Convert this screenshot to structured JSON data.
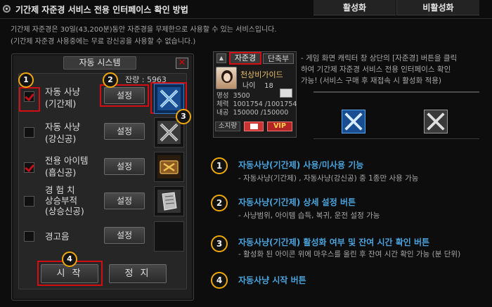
{
  "header": {
    "title": "기간제 자준경 서비스 전용 인터페이스 확인 방법"
  },
  "intro": [
    "기간제 자준경은 30일(43,200분)동안 자준경을 무제한으로 사용할 수 있는 서비스입니다.",
    "(기간제 자준경 사용중에는 무료 강신공을 사용할 수 없습니다.)"
  ],
  "panel": {
    "title": "자동 시스템",
    "close": "✕",
    "remaining": "잔량 : 5963",
    "rows": [
      {
        "label1": "자동 사냥",
        "label2": "(기간제)",
        "checked": true,
        "button": "설정"
      },
      {
        "label1": "자동 사냥",
        "label2": "(강신공)",
        "checked": false,
        "button": "설정"
      },
      {
        "label1": "전용 아이템",
        "label2": "(흡신공)",
        "checked": true,
        "button": "설정"
      },
      {
        "label1": "경 험 치",
        "label2": "상승부적",
        "label3": "(상승신공)",
        "checked": false,
        "button": "설정"
      },
      {
        "label1": "경고음",
        "label2": "",
        "checked": false,
        "button": "설정"
      }
    ],
    "start": "시 작",
    "stop": "정 지",
    "markers": [
      "1",
      "2",
      "3",
      "4"
    ]
  },
  "charwin": {
    "tab1": "자준경",
    "tab2": "단축부",
    "name": "천상비가이드",
    "age_label": "나이",
    "age": "18",
    "fame_label": "명성",
    "fame": "3500",
    "hp_label": "체력",
    "hp": "1001754 /1001754",
    "ki_label": "내공",
    "ki": "150000 /150000",
    "bag": "소지량",
    "vip": "VIP"
  },
  "note": [
    "- 게임 화면 캐릭터 창 상단의 [자준경] 버튼을 클릭",
    "하여 기간제 자준경 서비스 전용 인터페이스 확인",
    "가능! (서비스 구매 후 재접속 시 활성화 적용)"
  ],
  "table": {
    "active": "활성화",
    "inactive": "비활성화"
  },
  "items": [
    {
      "num": "1",
      "title": "자동사냥(기간제) 사용/미사용 기능",
      "desc": "- 자동사냥(기간제) , 자동사냥(강신공) 중 1종만 사용 가능"
    },
    {
      "num": "2",
      "title": "자동사냥(기간제) 상세 설정 버튼",
      "desc": "- 사냥범위,  아이템 습득, 복귀, 운전 설정 가능"
    },
    {
      "num": "3",
      "title": "자동사냥(기간제) 활성화 여부 및 잔여 시간 확인 버튼",
      "desc": "- 활성화 된 아이콘 위에 마우스를 올린 후 잔여 시간 확인 가능 (분 단위)"
    },
    {
      "num": "4",
      "title": "자동사냥 시작 버튼",
      "desc": ""
    }
  ],
  "colors": {
    "accent_blue": "#4aa3dc",
    "marker_orange": "#f0a810",
    "highlight_red": "#d20e14"
  }
}
